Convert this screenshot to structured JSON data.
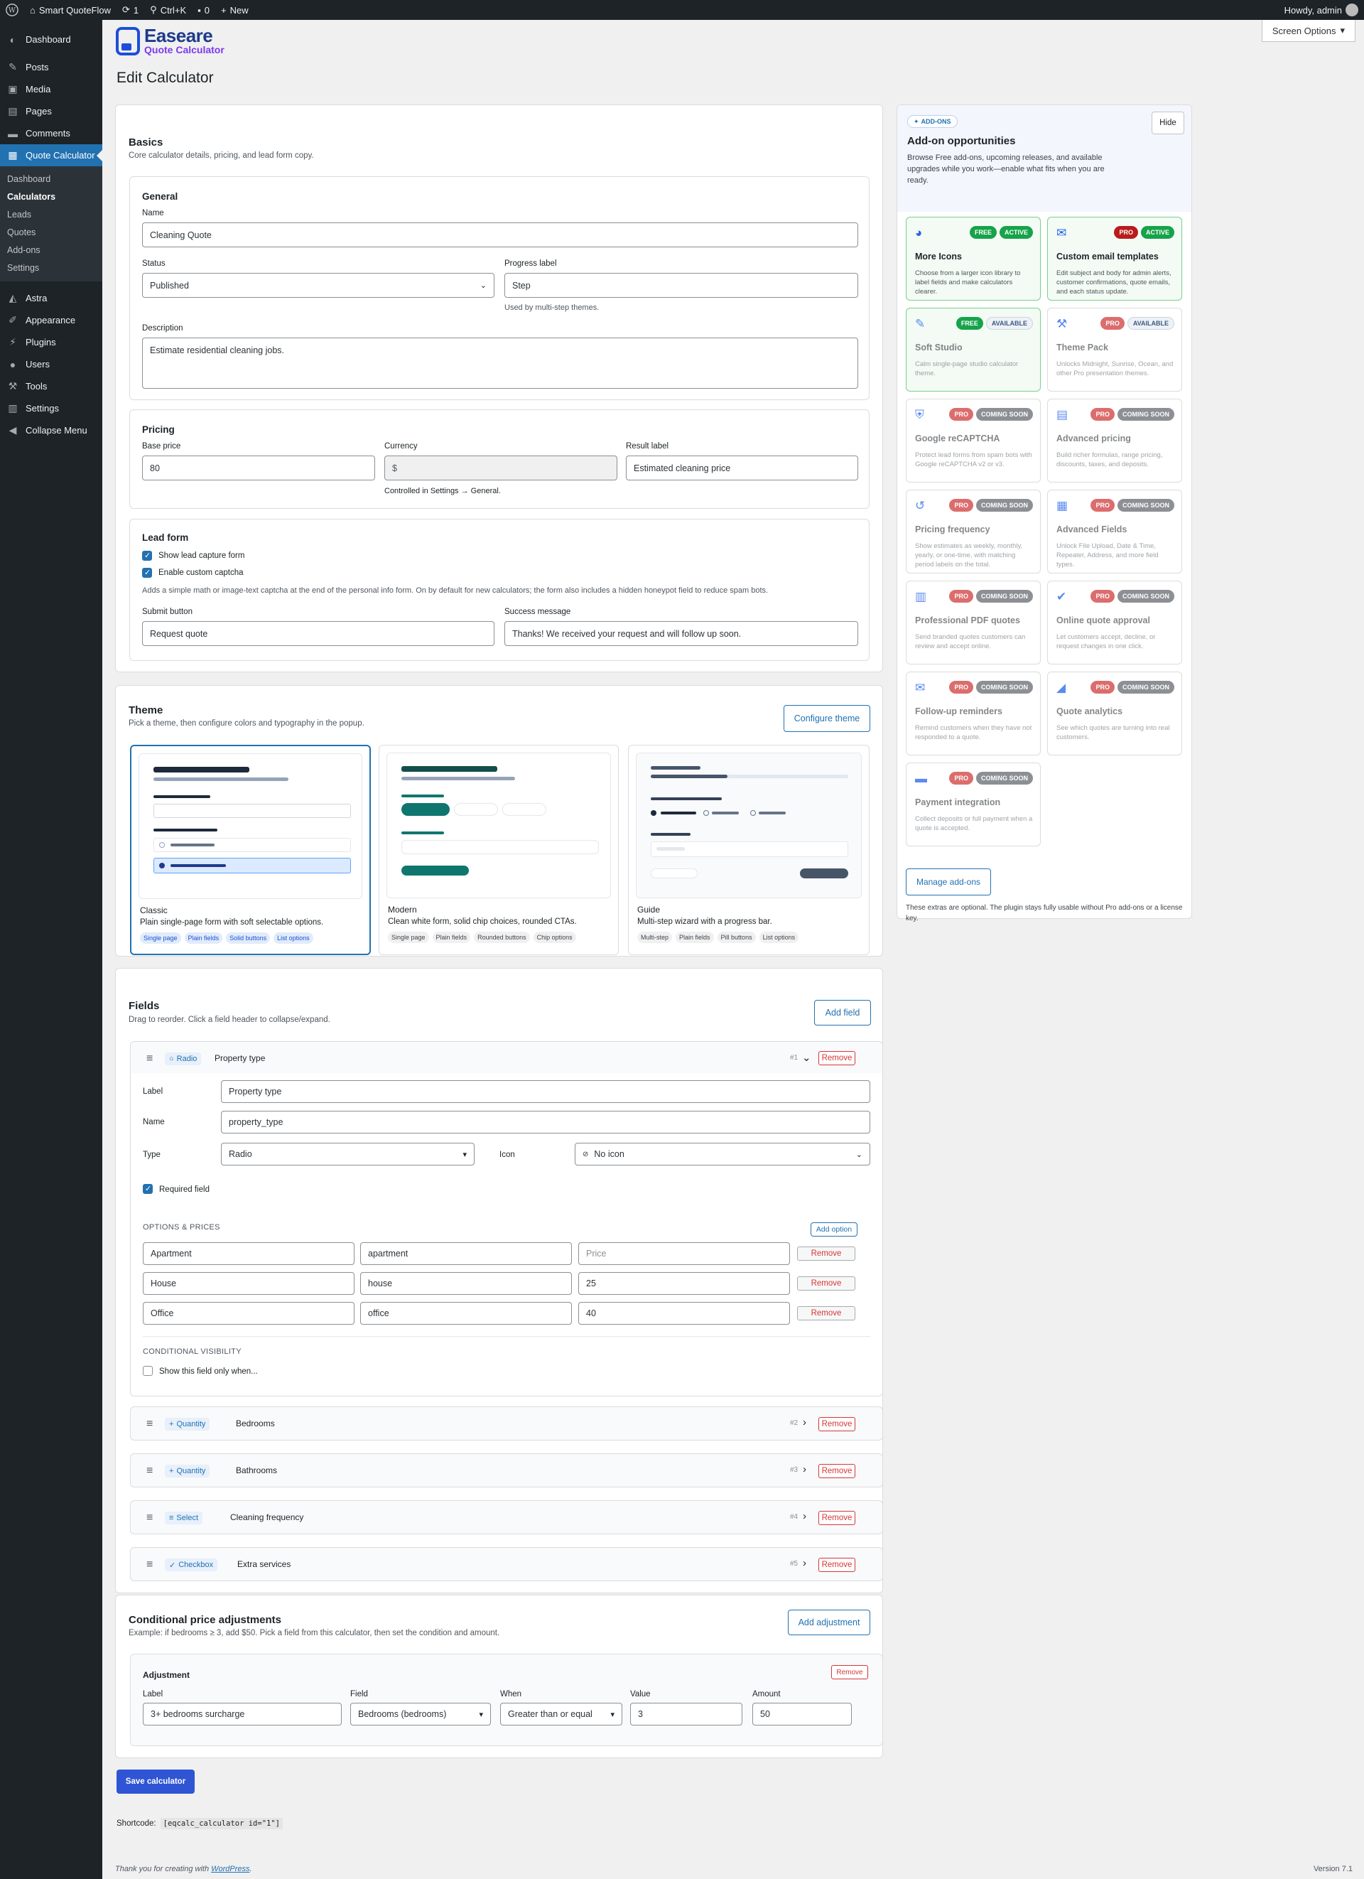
{
  "adminbar": {
    "site": "Smart QuoteFlow",
    "updates": "1",
    "search": "Ctrl+K",
    "comments": "0",
    "new": "New",
    "howdy": "Howdy, admin"
  },
  "sidebar": {
    "top": [
      {
        "label": "Dashboard",
        "icon": "dashboard-icon"
      }
    ],
    "group1": [
      {
        "label": "Posts"
      },
      {
        "label": "Media"
      },
      {
        "label": "Pages"
      },
      {
        "label": "Comments"
      }
    ],
    "current": "Quote Calculator",
    "sub": [
      "Dashboard",
      "Calculators",
      "Leads",
      "Quotes",
      "Add-ons",
      "Settings"
    ],
    "group2": [
      {
        "label": "Astra"
      },
      {
        "label": "Appearance"
      },
      {
        "label": "Plugins"
      },
      {
        "label": "Users"
      },
      {
        "label": "Tools"
      },
      {
        "label": "Settings"
      },
      {
        "label": "Collapse Menu"
      }
    ]
  },
  "screen_options": "Screen Options",
  "logo": {
    "line1": "Easeare",
    "line2": "Quote Calculator"
  },
  "page_title": "Edit Calculator",
  "basics": {
    "title": "Basics",
    "subtitle": "Core calculator details, pricing, and lead form copy.",
    "general": {
      "title": "General",
      "name_label": "Name",
      "name_value": "Cleaning Quote",
      "status_label": "Status",
      "status_value": "Published",
      "progress_label": "Progress label",
      "progress_value": "Step",
      "progress_hint": "Used by multi-step themes.",
      "description_label": "Description",
      "description_value": "Estimate residential cleaning jobs."
    },
    "pricing": {
      "title": "Pricing",
      "base_label": "Base price",
      "base_value": "80",
      "currency_label": "Currency",
      "currency_value": "$",
      "currency_hint": "Controlled in Settings → General.",
      "result_label": "Result label",
      "result_value": "Estimated cleaning price"
    },
    "lead": {
      "title": "Lead form",
      "show_label": "Show lead capture form",
      "captcha_label": "Enable custom captcha",
      "captcha_hint": "Adds a simple math or image-text captcha at the end of the personal info form. On by default for new calculators; the form also includes a hidden honeypot field to reduce spam bots.",
      "submit_label": "Submit button",
      "submit_value": "Request quote",
      "success_label": "Success message",
      "success_value": "Thanks! We received your request and will follow up soon."
    }
  },
  "theme": {
    "title": "Theme",
    "subtitle": "Pick a theme, then configure colors and typography in the popup.",
    "configure": "Configure theme",
    "cards": [
      {
        "name": "Classic",
        "desc": "Plain single-page form with soft selectable options.",
        "tags": [
          "Single page",
          "Plain fields",
          "Solid buttons",
          "List options"
        ]
      },
      {
        "name": "Modern",
        "desc": "Clean white form, solid chip choices, rounded CTAs.",
        "tags": [
          "Single page",
          "Plain fields",
          "Rounded buttons",
          "Chip options"
        ]
      },
      {
        "name": "Guide",
        "desc": "Multi-step wizard with a progress bar.",
        "tags": [
          "Multi-step",
          "Plain fields",
          "Pill buttons",
          "List options"
        ]
      }
    ]
  },
  "fields": {
    "title": "Fields",
    "subtitle": "Drag to reorder. Click a field header to collapse/expand.",
    "add": "Add field",
    "remove": "Remove",
    "expanded": {
      "type_chip": "Radio",
      "name": "Property type",
      "num": "#1",
      "label_label": "Label",
      "label_value": "Property type",
      "name_label": "Name",
      "name_value": "property_type",
      "type_label": "Type",
      "type_value": "Radio",
      "icon_label": "Icon",
      "icon_value": "No icon",
      "required": "Required field",
      "options_title": "OPTIONS & PRICES",
      "add_option": "Add option",
      "options": [
        {
          "label": "Apartment",
          "value": "apartment",
          "price": ""
        },
        {
          "label": "House",
          "value": "house",
          "price": "25"
        },
        {
          "label": "Office",
          "value": "office",
          "price": "40"
        }
      ],
      "price_placeholder": "Price",
      "cond_title": "CONDITIONAL VISIBILITY",
      "cond_label": "Show this field only when..."
    },
    "collapsed": [
      {
        "chip": "Quantity",
        "icon": "plus-icon",
        "name": "Bedrooms",
        "num": "#2"
      },
      {
        "chip": "Quantity",
        "icon": "plus-icon",
        "name": "Bathrooms",
        "num": "#3"
      },
      {
        "chip": "Select",
        "icon": "list-icon",
        "name": "Cleaning frequency",
        "num": "#4"
      },
      {
        "chip": "Checkbox",
        "icon": "check-icon",
        "name": "Extra services",
        "num": "#5"
      }
    ]
  },
  "adjust": {
    "title": "Conditional price adjustments",
    "subtitle": "Example: if bedrooms ≥ 3, add $50. Pick a field from this calculator, then set the condition and amount.",
    "add": "Add adjustment",
    "item": {
      "title": "Adjustment",
      "remove": "Remove",
      "label_label": "Label",
      "label_value": "3+ bedrooms surcharge",
      "field_label": "Field",
      "field_value": "Bedrooms (bedrooms)",
      "when_label": "When",
      "when_value": "Greater than or equal",
      "value_label": "Value",
      "value_value": "3",
      "amount_label": "Amount",
      "amount_value": "50"
    }
  },
  "addons": {
    "badge": "ADD-ONS",
    "hide": "Hide",
    "title": "Add-on opportunities",
    "desc": "Browse Free add-ons, upcoming releases, and available upgrades while you work—enable what fits when you are ready.",
    "tiles": [
      {
        "name": "More Icons",
        "desc": "Choose from a larger icon library to label fields and make calculators clearer.",
        "badges": [
          "FREE",
          "ACTIVE"
        ],
        "icon": "palette-icon"
      },
      {
        "name": "Custom email templates",
        "desc": "Edit subject and body for admin alerts, customer confirmations, quote emails, and each status update.",
        "badges": [
          "PRO",
          "ACTIVE"
        ],
        "icon": "mail-icon"
      },
      {
        "name": "Soft Studio",
        "desc": "Calm single-page studio calculator theme.",
        "badges": [
          "FREE",
          "AVAILABLE"
        ],
        "icon": "brush-icon"
      },
      {
        "name": "Theme Pack",
        "desc": "Unlocks Midnight, Sunrise, Ocean, and other Pro presentation themes.",
        "badges": [
          "PRO",
          "AVAILABLE"
        ],
        "icon": "hammer-icon"
      },
      {
        "name": "Google reCAPTCHA",
        "desc": "Protect lead forms from spam bots with Google reCAPTCHA v2 or v3.",
        "badges": [
          "PRO",
          "COMING SOON"
        ],
        "icon": "shield-icon"
      },
      {
        "name": "Advanced pricing",
        "desc": "Build richer formulas, range pricing, discounts, taxes, and deposits.",
        "badges": [
          "PRO",
          "COMING SOON"
        ],
        "icon": "document-icon"
      },
      {
        "name": "Pricing frequency",
        "desc": "Show estimates as weekly, monthly, yearly, or one-time, with matching period labels on the total.",
        "badges": [
          "PRO",
          "COMING SOON"
        ],
        "icon": "history-icon"
      },
      {
        "name": "Advanced Fields",
        "desc": "Unlock File Upload, Date & Time, Repeater, Address, and more field types.",
        "badges": [
          "PRO",
          "COMING SOON"
        ],
        "icon": "grid-icon"
      },
      {
        "name": "Professional PDF quotes",
        "desc": "Send branded quotes customers can review and accept online.",
        "badges": [
          "PRO",
          "COMING SOON"
        ],
        "icon": "pdf-icon"
      },
      {
        "name": "Online quote approval",
        "desc": "Let customers accept, decline, or request changes in one click.",
        "badges": [
          "PRO",
          "COMING SOON"
        ],
        "icon": "check-circle-icon"
      },
      {
        "name": "Follow-up reminders",
        "desc": "Remind customers when they have not responded to a quote.",
        "badges": [
          "PRO",
          "COMING SOON"
        ],
        "icon": "mail-icon"
      },
      {
        "name": "Quote analytics",
        "desc": "See which quotes are turning into real customers.",
        "badges": [
          "PRO",
          "COMING SOON"
        ],
        "icon": "chart-icon"
      },
      {
        "name": "Payment integration",
        "desc": "Collect deposits or full payment when a quote is accepted.",
        "badges": [
          "PRO",
          "COMING SOON"
        ],
        "icon": "cart-icon"
      }
    ],
    "manage": "Manage add-ons",
    "foot": "These extras are optional. The plugin stays fully usable without Pro add-ons or a license key."
  },
  "save": "Save calculator",
  "shortcode": {
    "label": "Shortcode:",
    "code": "[eqcalc_calculator id=\"1\"]"
  },
  "footer": {
    "thanks": "Thank you for creating with",
    "link": "WordPress",
    "version": "Version 7.1"
  }
}
